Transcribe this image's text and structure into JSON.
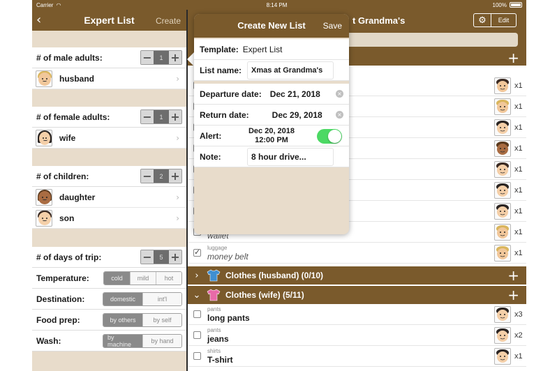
{
  "status": {
    "carrier": "Carrier",
    "time": "8:14 PM",
    "battery": "100%"
  },
  "left": {
    "title": "Expert List",
    "create": "Create",
    "male_label": "# of male adults:",
    "male_count": "1",
    "husband": "husband",
    "female_label": "# of female adults:",
    "female_count": "1",
    "wife": "wife",
    "children_label": "# of children:",
    "children_count": "2",
    "daughter": "daughter",
    "son": "son",
    "days_label": "# of days of trip:",
    "days_count": "5",
    "temperature": {
      "label": "Temperature:",
      "options": [
        "cold",
        "mild",
        "hot"
      ]
    },
    "destination": {
      "label": "Destination:",
      "options": [
        "domestic",
        "int'l"
      ]
    },
    "food": {
      "label": "Food prep:",
      "options": [
        "by others",
        "by self"
      ]
    },
    "wash": {
      "label": "Wash:",
      "options": [
        "by machine",
        "by hand"
      ]
    }
  },
  "right": {
    "title": "t Grandma's",
    "edit": "Edit",
    "partial_items": [
      {
        "cat": "",
        "item": "",
        "qty": "x1"
      },
      {
        "cat": "",
        "item": "",
        "qty": "x1"
      },
      {
        "cat": "",
        "item": "",
        "qty": "x1"
      },
      {
        "cat": "",
        "item": "",
        "qty": "x1"
      },
      {
        "cat": "",
        "item": "",
        "qty": "x1"
      },
      {
        "cat": "",
        "item": "",
        "qty": "x1"
      },
      {
        "cat": "",
        "item": "",
        "qty": "x1"
      },
      {
        "cat": "",
        "item": "wallet",
        "qty": "x1"
      },
      {
        "cat": "luggage",
        "item": "money belt",
        "qty": "x1"
      }
    ],
    "cat_husband": "Clothes (husband) (0/10)",
    "cat_wife": "Clothes (wife) (5/11)",
    "wife_items": [
      {
        "cat": "pants",
        "item": "long pants",
        "qty": "x3"
      },
      {
        "cat": "pants",
        "item": "jeans",
        "qty": "x2"
      },
      {
        "cat": "shirts",
        "item": "T-shirt",
        "qty": "x1"
      }
    ]
  },
  "popover": {
    "title": "Create New List",
    "save": "Save",
    "template_label": "Template:",
    "template_value": "Expert List",
    "name_label": "List name:",
    "name_value": "Xmas at Grandma's",
    "departure_label": "Departure date:",
    "departure_value": "Dec 21, 2018",
    "return_label": "Return date:",
    "return_value": "Dec 29, 2018",
    "alert_label": "Alert:",
    "alert_date": "Dec 20, 2018",
    "alert_time": "12:00 PM",
    "note_label": "Note:",
    "note_value": "8 hour drive..."
  },
  "colors": {
    "brand": "#7a5a2c",
    "panel": "#e8dccb",
    "toggle_on": "#4cd964"
  }
}
